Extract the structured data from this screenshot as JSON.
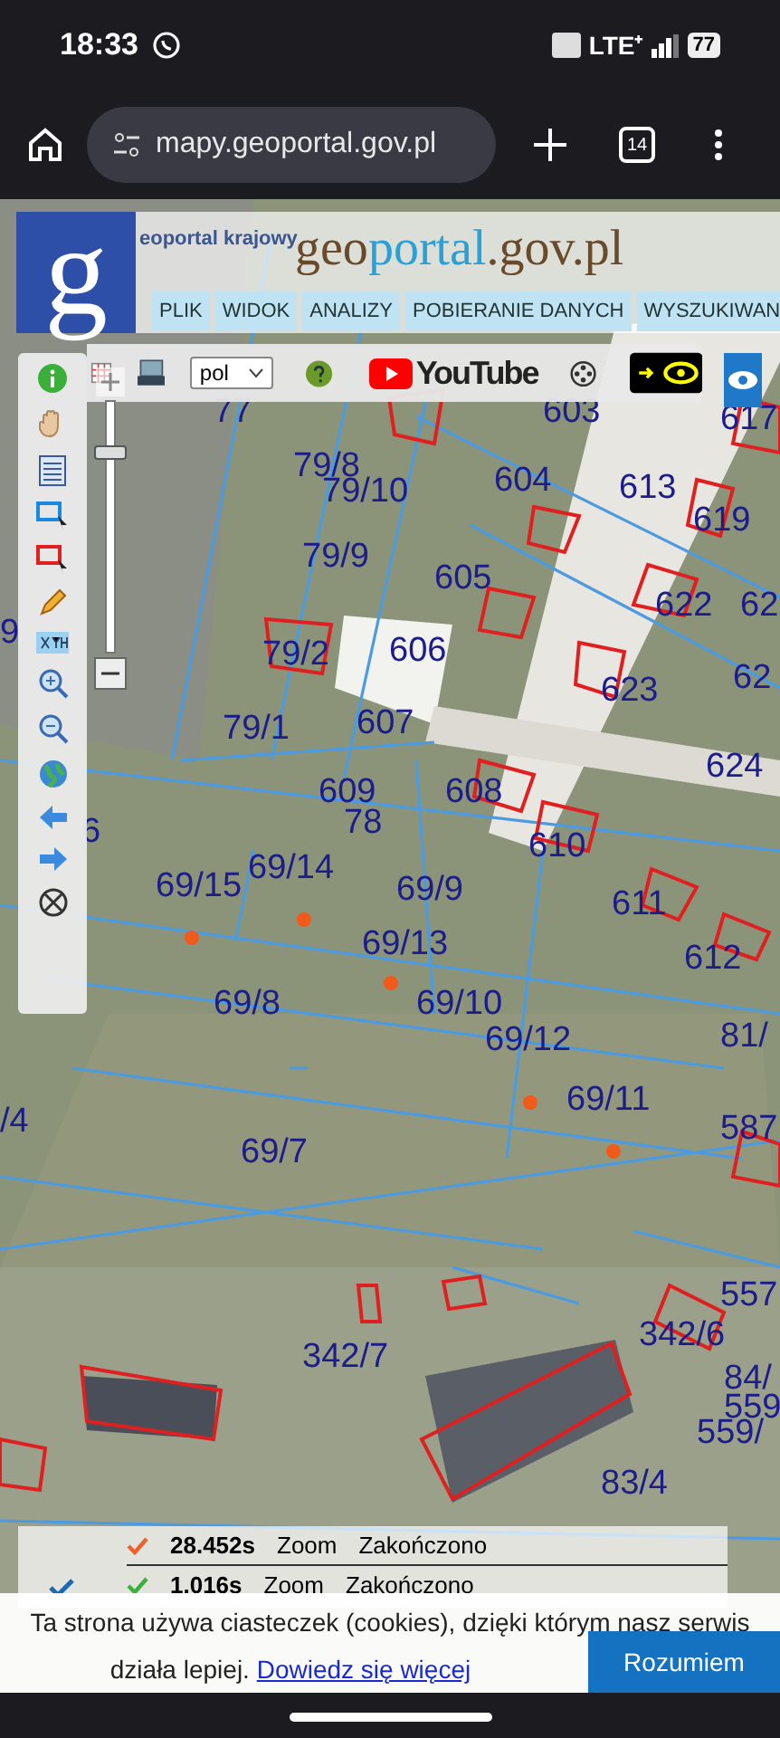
{
  "status_bar": {
    "time": "18:33",
    "network": "LTE⁺",
    "battery": "77"
  },
  "browser": {
    "url": "mapy.geoportal.gov.pl",
    "tab_count": "14"
  },
  "header": {
    "logo_letter": "g",
    "subtitle": "eoportal krajowy",
    "brand": [
      {
        "text": "geo",
        "kind": "dark"
      },
      {
        "text": "portal",
        "kind": "light"
      },
      {
        "text": ".gov.pl",
        "kind": "dark"
      }
    ],
    "menu": [
      "PLIK",
      "WIDOK",
      "ANALIZY",
      "POBIERANIE DANYCH",
      "WYSZUKIWAN"
    ]
  },
  "toolbar": {
    "language": "pol",
    "video_label": "YouTube"
  },
  "zoom_slider": {
    "level": 0.82
  },
  "map": {
    "parcels": [
      "77",
      "603",
      "617",
      "79/8",
      "79/10",
      "604",
      "613",
      "619",
      "79/9",
      "605",
      "622",
      "62",
      "79/2",
      "606",
      "623",
      "62",
      "607",
      "79/1",
      "624",
      "609",
      "608",
      "78",
      "6",
      "610",
      "69/14",
      "69/15",
      "69/9",
      "611",
      "69/13",
      "612",
      "69/8",
      "69/10",
      "69/12",
      "81/",
      "69/11",
      "/4",
      "587",
      "69/7",
      "557",
      "342/6",
      "342/7",
      "84/",
      "559",
      "559/",
      "83/4",
      "9"
    ]
  },
  "log": [
    {
      "time": "28.452s",
      "action": "Zoom",
      "status": "Zakończono",
      "kind": "warning"
    },
    {
      "time": "1.016s",
      "action": "Zoom",
      "status": "Zakończono",
      "kind": "ok"
    }
  ],
  "cookie_banner": {
    "text": "Ta strona używa ciasteczek (cookies), dzięki którym nasz serwis działa lepiej.",
    "link": "Dowiedz się więcej",
    "button": "Rozumiem"
  }
}
